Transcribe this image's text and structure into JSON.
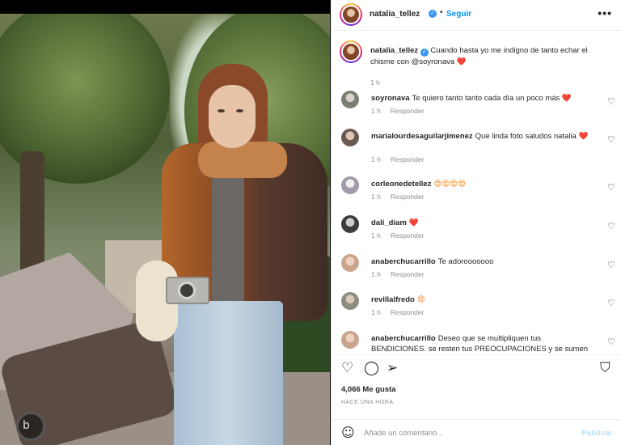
{
  "post": {
    "username": "natalia_tellez",
    "follow_label": "Seguir",
    "more_label": "•••",
    "caption": {
      "text": "Cuando hasta yo me indigno de tanto echar el chisme con @soyronava",
      "emoji": "❤️",
      "time": "1 h"
    }
  },
  "comments": [
    {
      "user": "soyronava",
      "text": "Te quiero tanto tanto cada día un poco más",
      "emoji": "❤️",
      "time": "1 h",
      "reply": "Responder",
      "avatar": "#7b7f72"
    },
    {
      "user": "marialourdesaguilarjimenez",
      "text": "Que linda foto saludos natalia",
      "emoji": "❤️",
      "time": "1 h",
      "reply": "Responder",
      "avatar": "#6b5a52"
    },
    {
      "user": "corleonedetellez",
      "text": "",
      "emoji": "😍😍😍😍",
      "time": "1 h",
      "reply": "Responder",
      "avatar": "#a29aa8"
    },
    {
      "user": "dali_diam",
      "text": "",
      "emoji": "❤️",
      "time": "1 h",
      "reply": "Responder",
      "avatar": "#3c3c3c"
    },
    {
      "user": "anaberchucarrillo",
      "text": "Te adorooooooo",
      "emoji": "",
      "time": "1 h",
      "reply": "Responder",
      "avatar": "#c9a58d"
    },
    {
      "user": "revillalfredo",
      "text": "",
      "emoji": "😍",
      "time": "1 h",
      "reply": "Responder",
      "avatar": "#8c8c80"
    },
    {
      "user": "anaberchucarrillo",
      "text": "Deseo que se multipliquen tus BENDICIONES. se resten tus PREOCUPACIONES y se sumen",
      "emoji": "",
      "time": "",
      "reply": "",
      "avatar": "#c9a58d"
    }
  ],
  "actions": {
    "likes": "4,066 Me gusta",
    "posted": "HACE UNA HORA"
  },
  "comment_box": {
    "placeholder": "Añade un comentario...",
    "publish_label": "Publicar"
  },
  "icons": {
    "like": "heart-icon",
    "comment": "comment-icon",
    "share": "share-icon",
    "save": "bookmark-icon",
    "emoji": "smile-icon",
    "more": "more-icon",
    "verified": "verified-icon"
  }
}
